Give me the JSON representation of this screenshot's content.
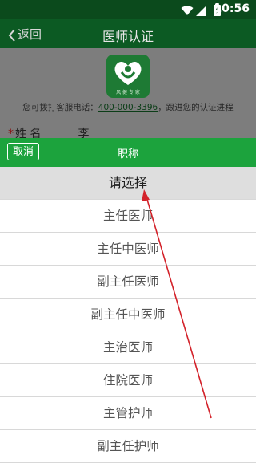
{
  "status": {
    "time": "10:56"
  },
  "header": {
    "back_label": "返回",
    "title": "医师认证"
  },
  "page": {
    "logo_caption": "风 健 专 家",
    "hotline_prefix": "您可拨打客服电话：",
    "hotline_number": "400-000-3396",
    "hotline_suffix": "，跟进您的认证进程",
    "name_label": "姓   名",
    "name_value": "李"
  },
  "picker": {
    "cancel_label": "取消",
    "title": "职称",
    "options": [
      "请选择",
      "主任医师",
      "主任中医师",
      "副主任医师",
      "副主任中医师",
      "主治医师",
      "住院医师",
      "主管护师",
      "副主任护师"
    ],
    "selected": "请选择"
  },
  "colors": {
    "picker_bar": "#1ca33d",
    "annotation_arrow": "#d3222a"
  }
}
